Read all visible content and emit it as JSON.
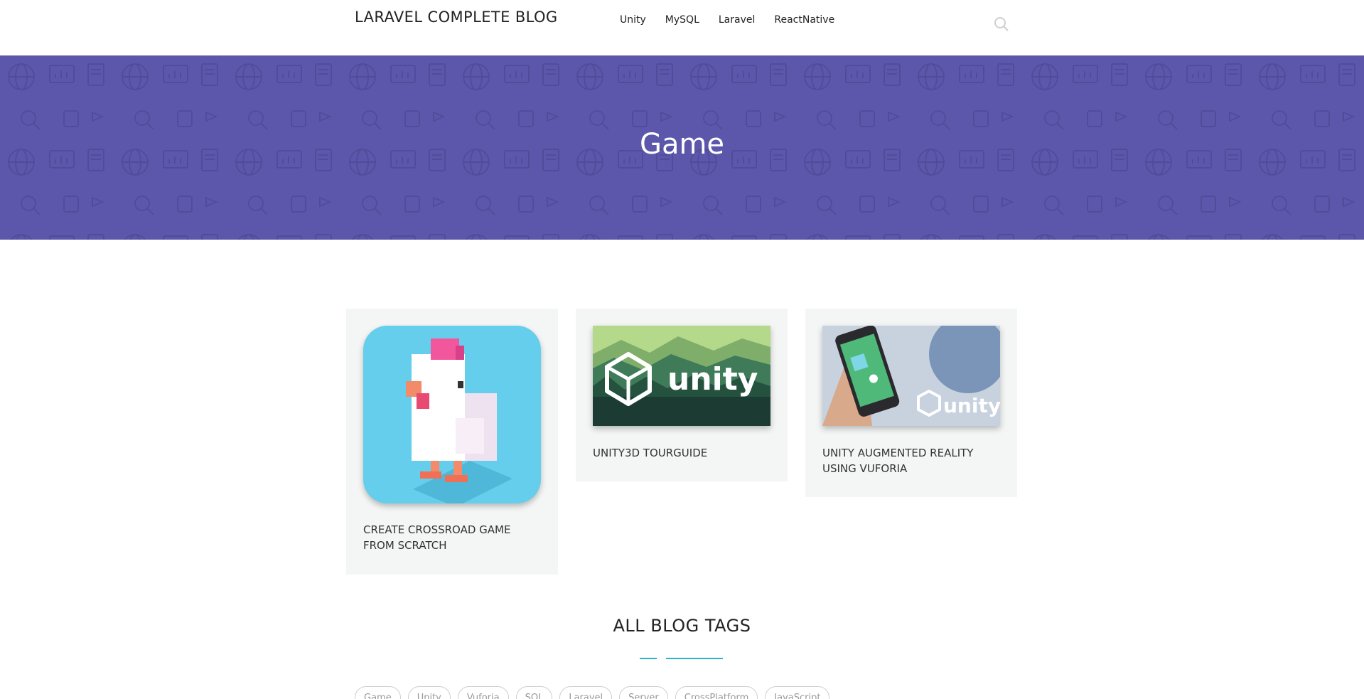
{
  "header": {
    "brand": "LARAVEL COMPLETE BLOG",
    "nav": [
      "Unity",
      "MySQL",
      "Laravel",
      "ReactNative"
    ]
  },
  "hero": {
    "title": "Game",
    "background_color": "#5c57aa"
  },
  "cards": [
    {
      "title": "CREATE CROSSROAD GAME FROM SCRATCH",
      "image": "crossy-chicken-image"
    },
    {
      "title": "UNITY3D TOURGUIDE",
      "image": "unity-forest-image",
      "logo_text": "unity"
    },
    {
      "title": "UNITY AUGMENTED REALITY USING VUFORIA",
      "image": "unity-phone-ar-image",
      "logo_text": "unity"
    }
  ],
  "tags_section": {
    "heading": "ALL BLOG TAGS",
    "tags": [
      "Game",
      "Unity",
      "Vuforia",
      "SQL",
      "Laravel",
      "Server",
      "CrossPlatform",
      "JavaScript"
    ],
    "accent_color": "#29b6c6"
  }
}
